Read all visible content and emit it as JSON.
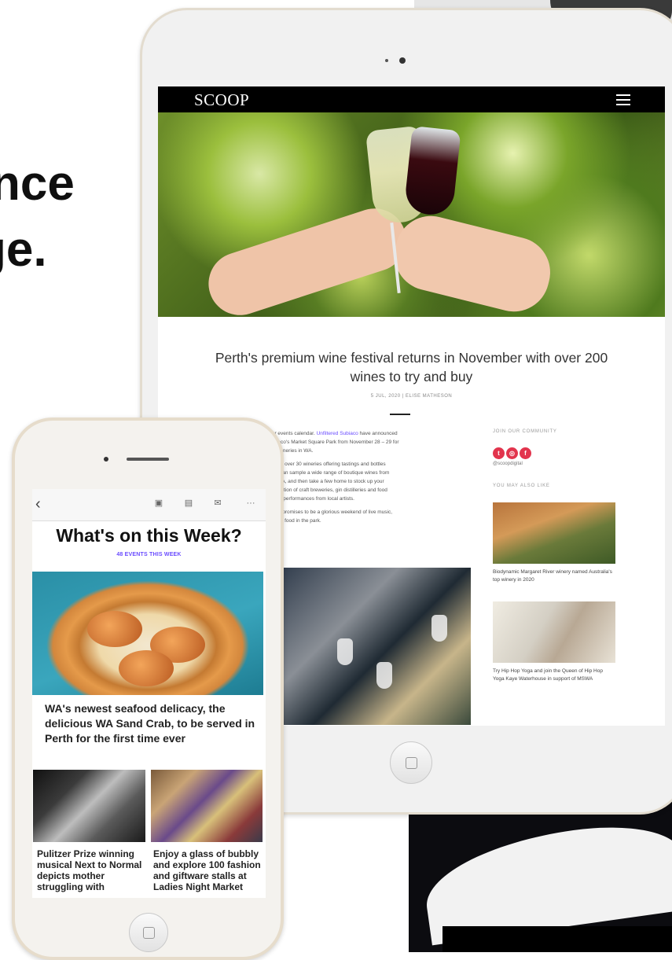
{
  "marketing": {
    "headline_line1": "nce",
    "headline_line2": "ge."
  },
  "tablet": {
    "site_logo": "SCOOP",
    "article_title": "Perth's premium wine festival returns in November with over 200 wines to try and buy",
    "article_meta": "5 JUL, 2020 | ELISE MATHESON",
    "body_p1_a": "m our events calendar. ",
    "body_p1_link": "Unfiltered Subiaco",
    "body_p1_b": " have announced",
    "body_p1_line2": "e Subiaco's Market Square Park from November 28 – 29 for",
    "body_p1_line3": "f local wineries in WA.",
    "body_p2_line1": "nes from over 30 wineries offering tastings and bottles",
    "body_p2_line2": "so you can sample a wide range of boutique wines from",
    "body_p2_line3": "cross WA, and then take a few home to stock up your",
    "body_p2_line4": "e a selection of craft breweries, gin distilleries and food",
    "body_p2_line5": "plus live performances from local artists.",
    "body_p3_line1": "vents, it promises to be a glorious weekend of live music,",
    "body_p3_line2": "delicious food in the park.",
    "sidebar_join": "JOIN OUR COMMUNITY",
    "sidebar_handle": "@scoopdigital",
    "sidebar_also": "YOU MAY ALSO LIKE",
    "related1": "Biodynamic Margaret River winery named Australia's top winery in 2020",
    "related2": "Try Hip Hop Yoga and join the Queen of Hip Hop Yoga Kaye Waterhouse in support of MSWA"
  },
  "phone": {
    "toolbar": {
      "back": "‹",
      "more": "···"
    },
    "week_title": "What's on this Week?",
    "week_sub": "48 EVENTS THIS WEEK",
    "feature_caption": "WA's newest seafood delicacy, the delicious WA Sand Crab, to be served in Perth for the first time ever",
    "card1_caption": "Pulitzer Prize winning musical Next to Normal depicts mother struggling with",
    "card2_caption": "Enjoy a glass of bubbly and explore 100 fashion and giftware stalls at Ladies Night Market"
  },
  "colors": {
    "accent_link": "#6a4cff",
    "social": "#e2344d"
  }
}
